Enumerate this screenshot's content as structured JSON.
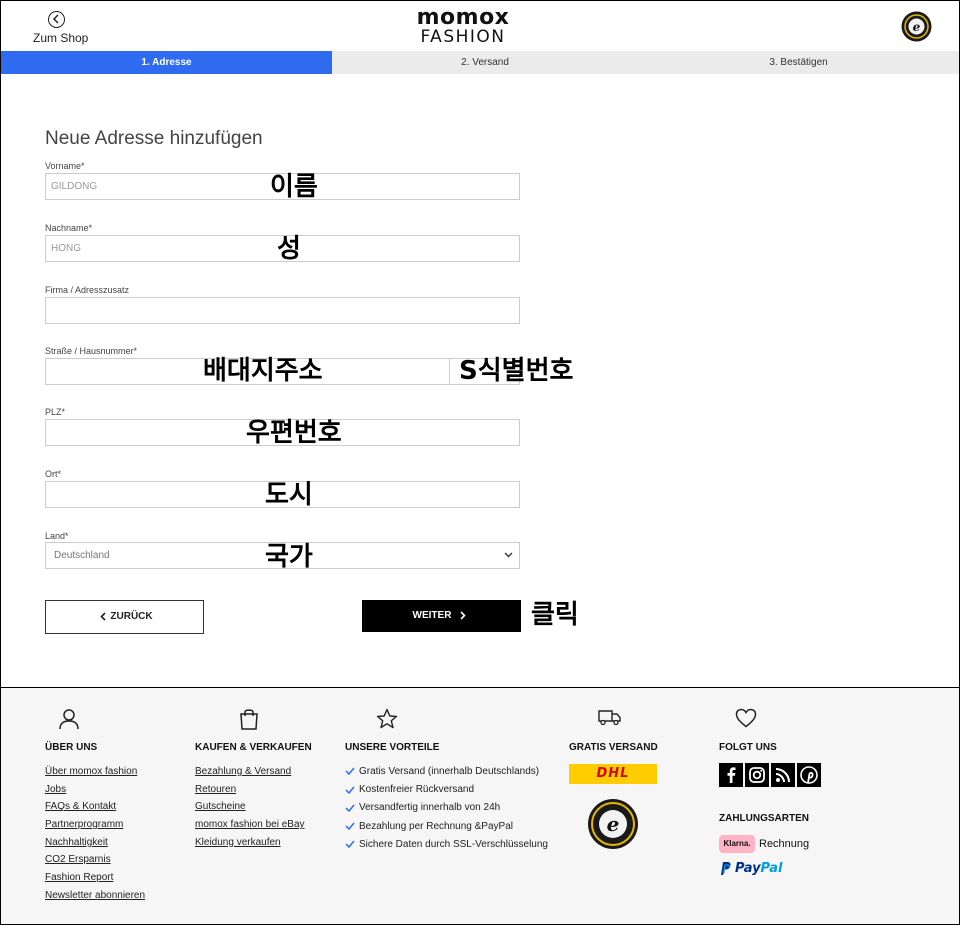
{
  "header": {
    "back_label": "Zum Shop",
    "logo_line1": "momox",
    "logo_line2": "FASHION"
  },
  "steps": [
    {
      "label": "1. Adresse",
      "active": true
    },
    {
      "label": "2. Versand",
      "active": false
    },
    {
      "label": "3. Bestätigen",
      "active": false
    }
  ],
  "form": {
    "title": "Neue Adresse hinzufügen",
    "vorname": {
      "label": "Vorname*",
      "value": "GILDONG"
    },
    "nachname": {
      "label": "Nachname*",
      "value": "HONG"
    },
    "firma": {
      "label": "Firma / Adresszusatz",
      "value": ""
    },
    "strasse": {
      "label": "Straße / Hausnummer*",
      "value": ""
    },
    "plz": {
      "label": "PLZ*",
      "value": ""
    },
    "ort": {
      "label": "Ort*",
      "value": ""
    },
    "land": {
      "label": "Land*",
      "value": "Deutschland"
    },
    "back_button": "ZURÜCK",
    "next_button": "WEITER"
  },
  "annotations": {
    "vorname": "이름",
    "nachname": "성",
    "strasse": "배대지주소",
    "hausnummer": "S식별번호",
    "plz": "우편번호",
    "ort": "도시",
    "land": "국가",
    "click": "클릭"
  },
  "footer": {
    "ueber_uns": {
      "heading": "ÜBER UNS",
      "links": [
        "Über momox fashion",
        "Jobs",
        "FAQs & Kontakt",
        "Partnerprogramm",
        "Nachhaltigkeit",
        "CO2 Ersparnis",
        "Fashion Report",
        "Newsletter abonnieren"
      ]
    },
    "kaufen": {
      "heading": "KAUFEN & VERKAUFEN",
      "links": [
        "Bezahlung & Versand",
        "Retouren",
        "Gutscheine",
        "momox fashion bei eBay",
        "Kleidung verkaufen"
      ]
    },
    "vorteile": {
      "heading": "UNSERE VORTEILE",
      "items": [
        "Gratis Versand (innerhalb Deutschlands)",
        "Kostenfreier Rückversand",
        "Versandfertig innerhalb von 24h",
        "Bezahlung per Rechnung &PayPal",
        "Sichere Daten durch SSL-Verschlüsselung"
      ]
    },
    "versand": {
      "heading": "GRATIS VERSAND",
      "dhl": "DHL"
    },
    "folgt": {
      "heading": "FOLGT UNS",
      "payments_heading": "ZAHLUNGSARTEN",
      "klarna_badge": "Klarna.",
      "klarna_text": "Rechnung",
      "paypal_a": "Pay",
      "paypal_b": "Pal"
    }
  }
}
